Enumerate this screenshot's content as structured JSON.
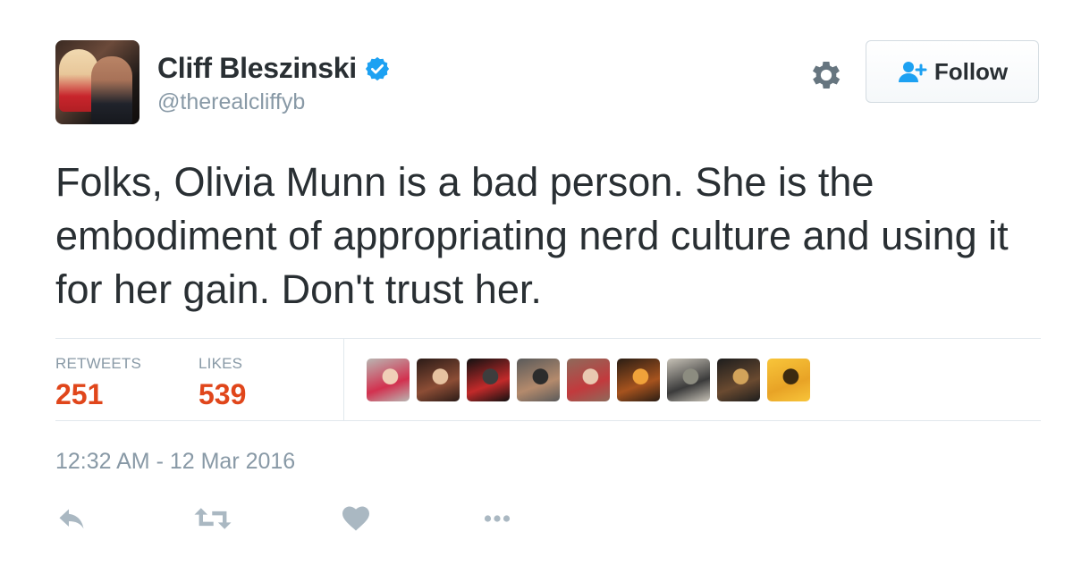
{
  "author": {
    "name": "Cliff Bleszinski",
    "handle": "@therealcliffyb",
    "verified": true
  },
  "follow_button": {
    "label": "Follow",
    "icon": "add-user-icon"
  },
  "tweet": {
    "text": "Folks, Olivia Munn is a bad person. She is the embodiment of appropriating nerd culture and using it for her gain. Don't trust her."
  },
  "stats": {
    "retweets_label": "RETWEETS",
    "retweets_count": "251",
    "likes_label": "LIKES",
    "likes_count": "539"
  },
  "likers": [
    {
      "name": "liker-avatar-1",
      "palette": [
        "#b9b6b2",
        "#d2314f",
        "#f0d0b8"
      ]
    },
    {
      "name": "liker-avatar-2",
      "palette": [
        "#2b1b17",
        "#8c4d35",
        "#e6c2a0"
      ]
    },
    {
      "name": "liker-avatar-3",
      "palette": [
        "#111111",
        "#c22a2a",
        "#3d3d3d"
      ]
    },
    {
      "name": "liker-avatar-4",
      "palette": [
        "#5a5a5a",
        "#b48a6c",
        "#2c2c2c"
      ]
    },
    {
      "name": "liker-avatar-5",
      "palette": [
        "#8e6a5b",
        "#c23a3d",
        "#e9c9b1"
      ]
    },
    {
      "name": "liker-avatar-6",
      "palette": [
        "#2a1d14",
        "#a6531e",
        "#f0a23a"
      ]
    },
    {
      "name": "liker-avatar-7",
      "palette": [
        "#c7c2b7",
        "#3b3b3b",
        "#8c8c80"
      ]
    },
    {
      "name": "liker-avatar-8",
      "palette": [
        "#1d1d1d",
        "#6a4a30",
        "#d2a35a"
      ]
    },
    {
      "name": "liker-avatar-9",
      "palette": [
        "#f8c53a",
        "#e8a326",
        "#3b2a10"
      ]
    }
  ],
  "timestamp": "12:32 AM - 12 Mar 2016",
  "actions": [
    "reply-icon",
    "retweet-icon",
    "like-icon",
    "more-icon"
  ],
  "colors": {
    "text": "#292f33",
    "muted": "#8899a6",
    "accent_blue": "#1da1f2",
    "stat_count": "#e0461b",
    "action_icon": "#aab8c2",
    "divider": "#e1e8ed"
  }
}
